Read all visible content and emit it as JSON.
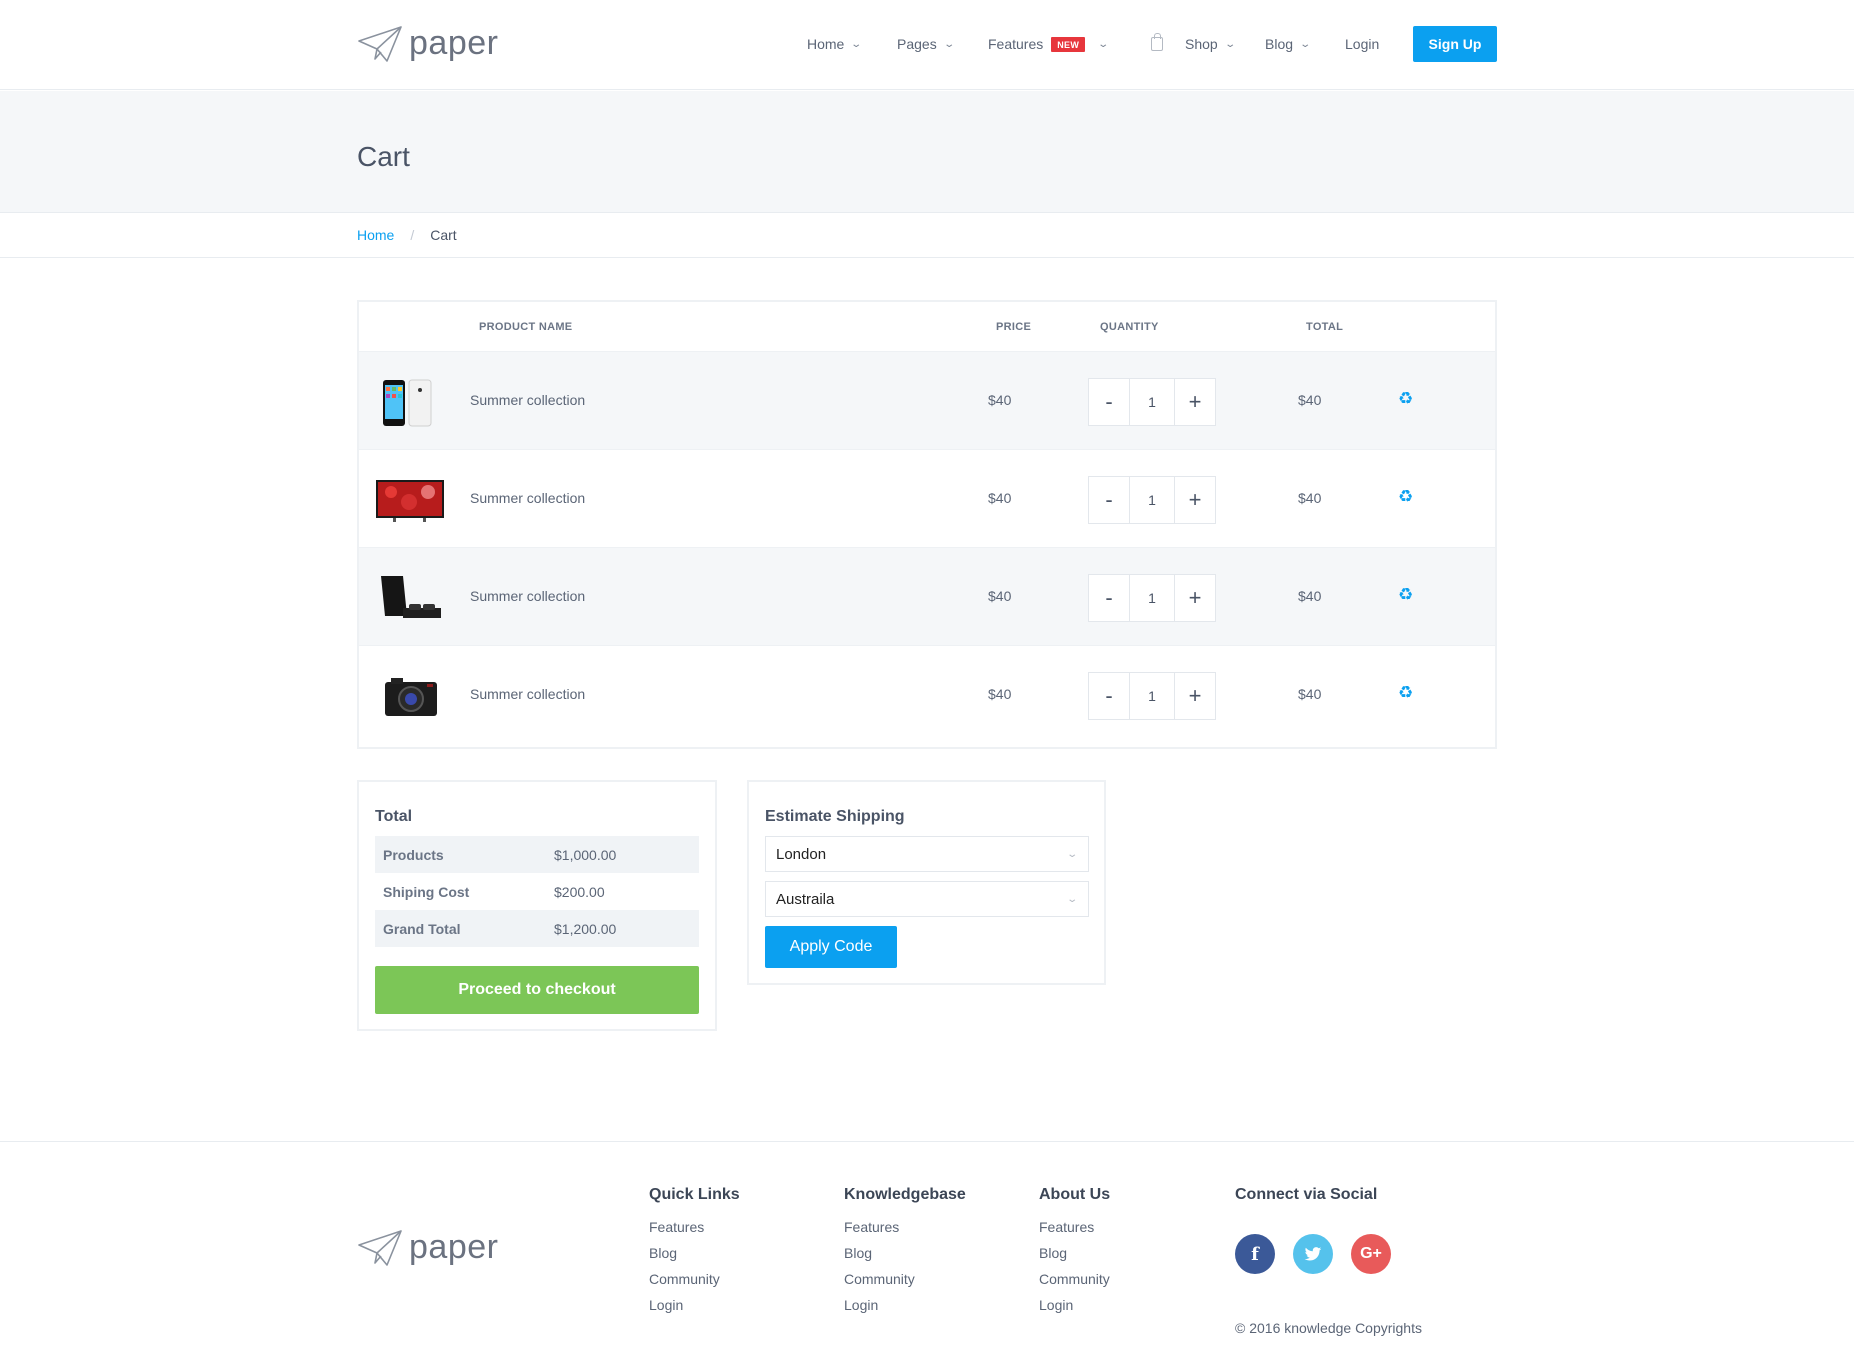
{
  "brand": {
    "name": "paper"
  },
  "nav": {
    "items": [
      {
        "label": "Home"
      },
      {
        "label": "Pages"
      },
      {
        "label": "Features",
        "badge": "NEW"
      },
      {
        "label": "Shop"
      },
      {
        "label": "Blog"
      },
      {
        "label": "Login"
      }
    ],
    "signup_label": "Sign Up"
  },
  "page": {
    "title": "Cart"
  },
  "breadcrumb": {
    "home": "Home",
    "current": "Cart"
  },
  "cart": {
    "headers": {
      "product": "PRODUCT NAME",
      "price": "PRICE",
      "quantity": "QUANTITY",
      "total": "TOTAL"
    },
    "rows": [
      {
        "name": "Summer collection",
        "price": "$40",
        "qty": "1",
        "total": "$40",
        "thumb": "smartphone"
      },
      {
        "name": "Summer collection",
        "price": "$40",
        "qty": "1",
        "total": "$40",
        "thumb": "television"
      },
      {
        "name": "Summer collection",
        "price": "$40",
        "qty": "1",
        "total": "$40",
        "thumb": "game-console"
      },
      {
        "name": "Summer collection",
        "price": "$40",
        "qty": "1",
        "total": "$40",
        "thumb": "camera"
      }
    ],
    "minus": "-",
    "plus": "+",
    "remove_icon": "♻"
  },
  "totals": {
    "title": "Total",
    "rows": [
      {
        "label": "Products",
        "value": "$1,000.00"
      },
      {
        "label": "Shiping Cost",
        "value": "$200.00"
      },
      {
        "label": "Grand Total",
        "value": "$1,200.00"
      }
    ],
    "checkout_label": "Proceed to checkout"
  },
  "shipping": {
    "title": "Estimate Shipping",
    "city": "London",
    "country": "Austraila",
    "apply_label": "Apply Code"
  },
  "footer": {
    "columns": [
      {
        "title": "Quick Links",
        "links": [
          "Features",
          "Blog",
          "Community",
          "Login"
        ]
      },
      {
        "title": "Knowledgebase",
        "links": [
          "Features",
          "Blog",
          "Community",
          "Login"
        ]
      },
      {
        "title": "About Us",
        "links": [
          "Features",
          "Blog",
          "Community",
          "Login"
        ]
      }
    ],
    "social_title": "Connect via Social",
    "social": [
      {
        "icon": "facebook-icon",
        "glyph": "f",
        "color": "#3b5998"
      },
      {
        "icon": "twitter-icon",
        "glyph": "t",
        "color": "#55c2ec"
      },
      {
        "icon": "google-plus-icon",
        "glyph": "G+",
        "color": "#e85a5a"
      }
    ],
    "copyright": "© 2016 knowledge Copyrights"
  },
  "colors": {
    "accent": "#0ba0f0",
    "success": "#7cc657",
    "badge": "#e7363c"
  }
}
